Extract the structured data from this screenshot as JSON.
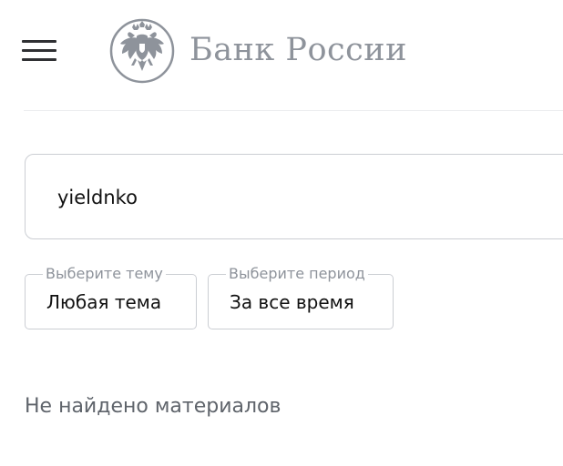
{
  "header": {
    "menu_icon": "hamburger-menu-icon",
    "logo": {
      "emblem_icon": "double-headed-eagle-emblem-icon",
      "text": "Банк России",
      "color": "#8e939b"
    }
  },
  "search": {
    "value": "yieldnko"
  },
  "filters": {
    "topic": {
      "legend": "Выберите тему",
      "value": "Любая тема"
    },
    "period": {
      "legend": "Выберите период",
      "value": "За все время"
    }
  },
  "results": {
    "empty_message": "Не найдено материалов"
  },
  "colors": {
    "text": "#111111",
    "muted_text": "#5f646b",
    "border": "#cbced3",
    "divider": "#ebecef"
  }
}
